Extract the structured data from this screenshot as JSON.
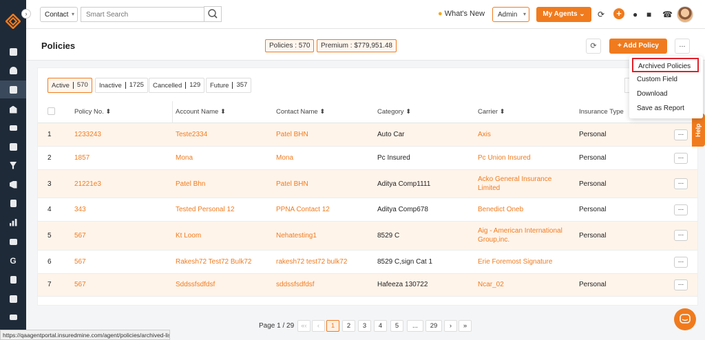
{
  "topbar": {
    "contact_select": "Contact",
    "search_placeholder": "Smart Search",
    "whats_new": "What's New",
    "admin_select": "Admin",
    "my_agents": "My Agents"
  },
  "header": {
    "title": "Policies",
    "policies_badge": "Policies : 570",
    "premium_badge": "Premium : $779,951.48",
    "add_policy": "Add Policy"
  },
  "dropdown": {
    "items": [
      "Archived Policies",
      "Custom Field",
      "Download",
      "Save as Report"
    ]
  },
  "status_tabs": [
    {
      "label": "Active",
      "count": "570"
    },
    {
      "label": "Inactive",
      "count": "1725"
    },
    {
      "label": "Cancelled",
      "count": "129"
    },
    {
      "label": "Future",
      "count": "357"
    }
  ],
  "table": {
    "columns": [
      "Policy No.",
      "Account Name",
      "Contact Name",
      "Category",
      "Carrier",
      "Insurance Type"
    ],
    "rows": [
      {
        "n": "1",
        "policy": "1233243",
        "account": "Teste2334",
        "contact": "Patel BHN",
        "category": "Auto Car",
        "carrier": "Axis",
        "type": "Personal"
      },
      {
        "n": "2",
        "policy": "1857",
        "account": "Mona",
        "contact": "Mona",
        "category": "Pc Insured",
        "carrier": "Pc Union Insured",
        "type": "Personal"
      },
      {
        "n": "3",
        "policy": "21221e3",
        "account": "Patel Bhn",
        "contact": "Patel BHN",
        "category": "Aditya Comp1111",
        "carrier": "Acko General Insurance Limited",
        "type": "Personal"
      },
      {
        "n": "4",
        "policy": "343",
        "account": "Tested Personal 12",
        "contact": "PPNA Contact 12",
        "category": "Aditya Comp678",
        "carrier": "Benedict Oneb",
        "type": "Personal"
      },
      {
        "n": "5",
        "policy": "567",
        "account": "Kt Loom",
        "contact": "Nehatesting1",
        "category": "8529 C",
        "carrier": "Aig - American International Group,inc.",
        "type": "Personal"
      },
      {
        "n": "6",
        "policy": "567",
        "account": "Rakesh72 Test72 Bulk72",
        "contact": "rakesh72 test72 bulk72",
        "category": "8529 C,sign Cat 1",
        "carrier": "Erie Foremost Signature",
        "type": ""
      },
      {
        "n": "7",
        "policy": "567",
        "account": "Sddssfsdfdsf",
        "contact": "sddssfsdfdsf",
        "category": "Hafeeza 130722",
        "carrier": "Ncar_02",
        "type": "Personal"
      }
    ]
  },
  "pagination": {
    "label": "Page 1 / 29",
    "pages": [
      "1",
      "2",
      "3",
      "4",
      "5",
      "...",
      "29"
    ]
  },
  "help_tab": "Help",
  "status_url": "https://qaagentportal.insuredmine.com/agent/policies/archived-list",
  "colors": {
    "accent": "#f07b1e",
    "sidebar": "#1e2a38",
    "highlight_border": "#e0202a",
    "row_alt": "#fff4ea"
  }
}
